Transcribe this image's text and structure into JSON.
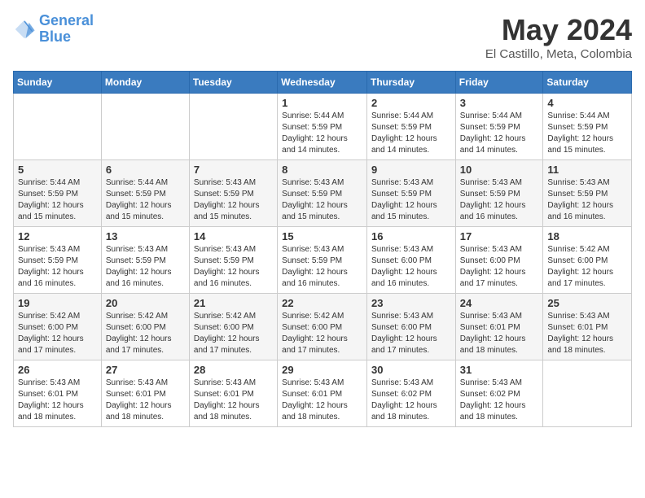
{
  "header": {
    "logo_line1": "General",
    "logo_line2": "Blue",
    "month_title": "May 2024",
    "location": "El Castillo, Meta, Colombia"
  },
  "weekdays": [
    "Sunday",
    "Monday",
    "Tuesday",
    "Wednesday",
    "Thursday",
    "Friday",
    "Saturday"
  ],
  "weeks": [
    [
      {
        "day": "",
        "info": ""
      },
      {
        "day": "",
        "info": ""
      },
      {
        "day": "",
        "info": ""
      },
      {
        "day": "1",
        "info": "Sunrise: 5:44 AM\nSunset: 5:59 PM\nDaylight: 12 hours\nand 14 minutes."
      },
      {
        "day": "2",
        "info": "Sunrise: 5:44 AM\nSunset: 5:59 PM\nDaylight: 12 hours\nand 14 minutes."
      },
      {
        "day": "3",
        "info": "Sunrise: 5:44 AM\nSunset: 5:59 PM\nDaylight: 12 hours\nand 14 minutes."
      },
      {
        "day": "4",
        "info": "Sunrise: 5:44 AM\nSunset: 5:59 PM\nDaylight: 12 hours\nand 15 minutes."
      }
    ],
    [
      {
        "day": "5",
        "info": "Sunrise: 5:44 AM\nSunset: 5:59 PM\nDaylight: 12 hours\nand 15 minutes."
      },
      {
        "day": "6",
        "info": "Sunrise: 5:44 AM\nSunset: 5:59 PM\nDaylight: 12 hours\nand 15 minutes."
      },
      {
        "day": "7",
        "info": "Sunrise: 5:43 AM\nSunset: 5:59 PM\nDaylight: 12 hours\nand 15 minutes."
      },
      {
        "day": "8",
        "info": "Sunrise: 5:43 AM\nSunset: 5:59 PM\nDaylight: 12 hours\nand 15 minutes."
      },
      {
        "day": "9",
        "info": "Sunrise: 5:43 AM\nSunset: 5:59 PM\nDaylight: 12 hours\nand 15 minutes."
      },
      {
        "day": "10",
        "info": "Sunrise: 5:43 AM\nSunset: 5:59 PM\nDaylight: 12 hours\nand 16 minutes."
      },
      {
        "day": "11",
        "info": "Sunrise: 5:43 AM\nSunset: 5:59 PM\nDaylight: 12 hours\nand 16 minutes."
      }
    ],
    [
      {
        "day": "12",
        "info": "Sunrise: 5:43 AM\nSunset: 5:59 PM\nDaylight: 12 hours\nand 16 minutes."
      },
      {
        "day": "13",
        "info": "Sunrise: 5:43 AM\nSunset: 5:59 PM\nDaylight: 12 hours\nand 16 minutes."
      },
      {
        "day": "14",
        "info": "Sunrise: 5:43 AM\nSunset: 5:59 PM\nDaylight: 12 hours\nand 16 minutes."
      },
      {
        "day": "15",
        "info": "Sunrise: 5:43 AM\nSunset: 5:59 PM\nDaylight: 12 hours\nand 16 minutes."
      },
      {
        "day": "16",
        "info": "Sunrise: 5:43 AM\nSunset: 6:00 PM\nDaylight: 12 hours\nand 16 minutes."
      },
      {
        "day": "17",
        "info": "Sunrise: 5:43 AM\nSunset: 6:00 PM\nDaylight: 12 hours\nand 17 minutes."
      },
      {
        "day": "18",
        "info": "Sunrise: 5:42 AM\nSunset: 6:00 PM\nDaylight: 12 hours\nand 17 minutes."
      }
    ],
    [
      {
        "day": "19",
        "info": "Sunrise: 5:42 AM\nSunset: 6:00 PM\nDaylight: 12 hours\nand 17 minutes."
      },
      {
        "day": "20",
        "info": "Sunrise: 5:42 AM\nSunset: 6:00 PM\nDaylight: 12 hours\nand 17 minutes."
      },
      {
        "day": "21",
        "info": "Sunrise: 5:42 AM\nSunset: 6:00 PM\nDaylight: 12 hours\nand 17 minutes."
      },
      {
        "day": "22",
        "info": "Sunrise: 5:42 AM\nSunset: 6:00 PM\nDaylight: 12 hours\nand 17 minutes."
      },
      {
        "day": "23",
        "info": "Sunrise: 5:43 AM\nSunset: 6:00 PM\nDaylight: 12 hours\nand 17 minutes."
      },
      {
        "day": "24",
        "info": "Sunrise: 5:43 AM\nSunset: 6:01 PM\nDaylight: 12 hours\nand 18 minutes."
      },
      {
        "day": "25",
        "info": "Sunrise: 5:43 AM\nSunset: 6:01 PM\nDaylight: 12 hours\nand 18 minutes."
      }
    ],
    [
      {
        "day": "26",
        "info": "Sunrise: 5:43 AM\nSunset: 6:01 PM\nDaylight: 12 hours\nand 18 minutes."
      },
      {
        "day": "27",
        "info": "Sunrise: 5:43 AM\nSunset: 6:01 PM\nDaylight: 12 hours\nand 18 minutes."
      },
      {
        "day": "28",
        "info": "Sunrise: 5:43 AM\nSunset: 6:01 PM\nDaylight: 12 hours\nand 18 minutes."
      },
      {
        "day": "29",
        "info": "Sunrise: 5:43 AM\nSunset: 6:01 PM\nDaylight: 12 hours\nand 18 minutes."
      },
      {
        "day": "30",
        "info": "Sunrise: 5:43 AM\nSunset: 6:02 PM\nDaylight: 12 hours\nand 18 minutes."
      },
      {
        "day": "31",
        "info": "Sunrise: 5:43 AM\nSunset: 6:02 PM\nDaylight: 12 hours\nand 18 minutes."
      },
      {
        "day": "",
        "info": ""
      }
    ]
  ]
}
